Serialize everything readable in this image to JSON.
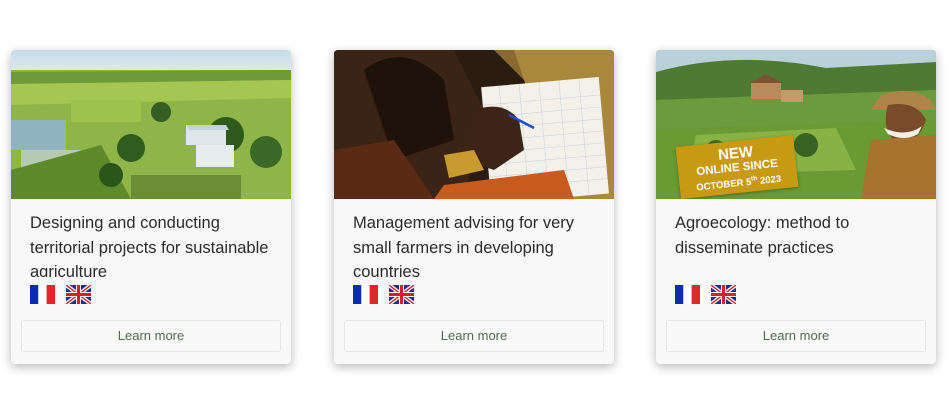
{
  "cards": [
    {
      "title": "Designing and conducting territorial projects for sustainable agriculture",
      "learn_more": "Learn more",
      "image": "aerial-farm-landscape"
    },
    {
      "title": "Management advising for very small farmers in developing countries",
      "learn_more": "Learn more",
      "image": "farmer-writing-notes"
    },
    {
      "title": "Agroecology: method to disseminate practices",
      "learn_more": "Learn more",
      "image": "farmer-in-hat-village",
      "badge": {
        "line1": "NEW",
        "line2": "ONLINE SINCE",
        "line3_pre": "OCTOBER 5",
        "line3_sup": "th",
        "line3_post": " 2023"
      }
    }
  ],
  "flags": {
    "french": "flag-france-icon",
    "english": "flag-uk-icon"
  },
  "colors": {
    "badge": "#c89a12",
    "learn_more_text": "#4b6b4b"
  }
}
